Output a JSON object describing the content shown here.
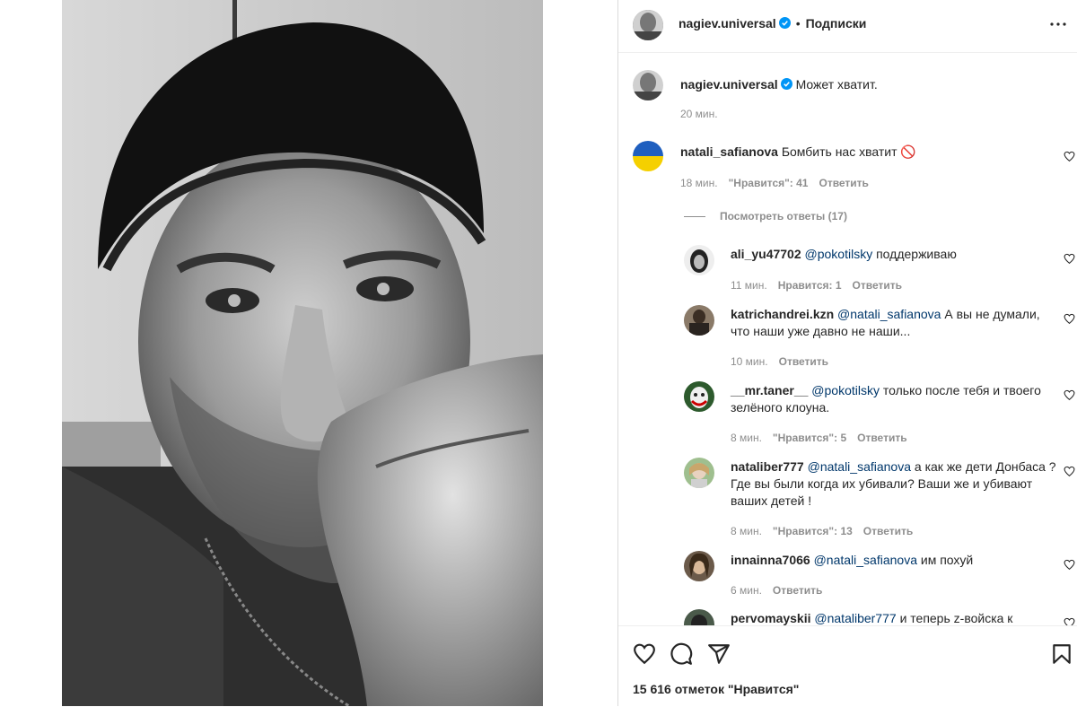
{
  "header": {
    "username": "nagiev.universal",
    "separator": "•",
    "follow_label": "Подписки"
  },
  "caption": {
    "username": "nagiev.universal",
    "text": "Может хватит.",
    "time": "20 мин."
  },
  "comments": [
    {
      "username": "natali_safianova",
      "text": "Бомбить нас хватит 🚫",
      "time": "18 мин.",
      "likes": "\"Нравится\": 41",
      "reply": "Ответить",
      "view_replies": "Посмотреть ответы (17)"
    }
  ],
  "replies": [
    {
      "username": "ali_yu47702",
      "mention": "@pokotilsky",
      "text": "поддерживаю",
      "time": "11 мин.",
      "likes": "Нравится: 1",
      "reply": "Ответить"
    },
    {
      "username": "katrichandrei.kzn",
      "mention": "@natali_safianova",
      "text": "А вы не думали, что наши уже давно не наши...",
      "time": "10 мин.",
      "likes": "",
      "reply": "Ответить"
    },
    {
      "username": "__mr.taner__",
      "mention": "@pokotilsky",
      "text": "только после тебя и твоего зелёного клоуна.",
      "time": "8 мин.",
      "likes": "\"Нравится\": 5",
      "reply": "Ответить"
    },
    {
      "username": "nataliber777",
      "mention": "@natali_safianova",
      "text": "а как же дети Донбаса ? Где вы были когда их убивали? Ваши же и убивают ваших детей !",
      "time": "8 мин.",
      "likes": "\"Нравится\": 13",
      "reply": "Ответить"
    },
    {
      "username": "innainna7066",
      "mention": "@natali_safianova",
      "text": "им похуй",
      "time": "6 мин.",
      "likes": "",
      "reply": "Ответить"
    },
    {
      "username": "pervomayskii",
      "mention": "@nataliber777",
      "text": "и теперь z-войска к",
      "time": "",
      "likes": "",
      "reply": ""
    }
  ],
  "actions": {
    "like_icon": "heart-icon",
    "comment_icon": "comment-icon",
    "share_icon": "share-icon",
    "save_icon": "bookmark-icon",
    "likes_count": "15 616 отметок \"Нравится\""
  },
  "colors": {
    "verified": "#0095f6",
    "muted": "#8e8e8e",
    "mention": "#00376b",
    "text": "#262626"
  }
}
